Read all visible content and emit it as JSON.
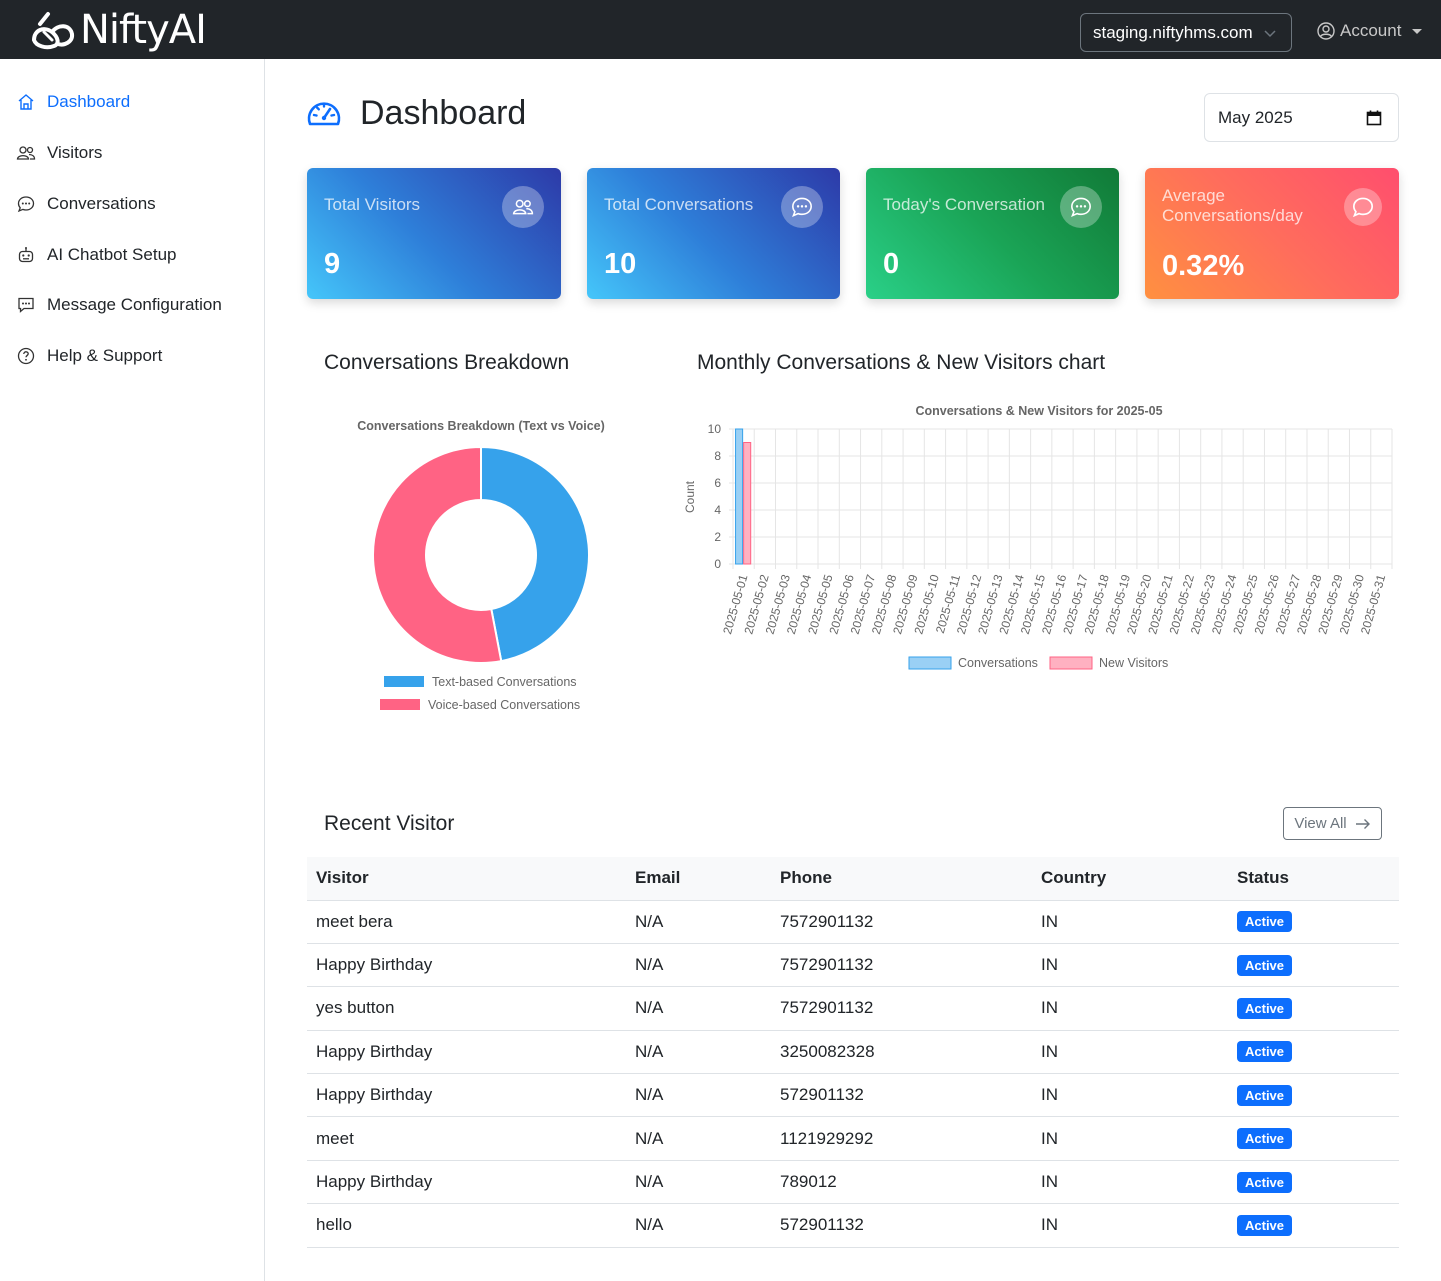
{
  "header": {
    "brand": "NiftyAI",
    "domain": "staging.niftyhms.com",
    "account_label": "Account"
  },
  "sidebar": {
    "items": [
      {
        "label": "Dashboard",
        "icon": "home-icon",
        "active": true
      },
      {
        "label": "Visitors",
        "icon": "people-icon"
      },
      {
        "label": "Conversations",
        "icon": "chat-dots-icon"
      },
      {
        "label": "AI Chatbot Setup",
        "icon": "robot-icon"
      },
      {
        "label": "Message Configuration",
        "icon": "message-square-icon"
      },
      {
        "label": "Help & Support",
        "icon": "question-circle-icon"
      }
    ]
  },
  "page": {
    "title": "Dashboard",
    "month": "May 2025"
  },
  "cards": [
    {
      "label": "Total Visitors",
      "value": "9",
      "icon": "people-icon"
    },
    {
      "label": "Total Conversations",
      "value": "10",
      "icon": "chat-dots-icon"
    },
    {
      "label": "Today's Conversation",
      "value": "0",
      "icon": "chat-dots-icon"
    },
    {
      "label": "Average Conversations/day",
      "value": "0.32%",
      "icon": "chat-icon"
    }
  ],
  "sections": {
    "breakdown_title": "Conversations Breakdown",
    "monthly_title": "Monthly Conversations & New Visitors chart",
    "recent_title": "Recent Visitor",
    "view_all": "View All"
  },
  "colors": {
    "primary": "#0d6efd",
    "text_series": "#36a2eb",
    "voice_series": "#ff6384"
  },
  "chart_data": [
    {
      "type": "pie",
      "title": "Conversations Breakdown (Text vs Voice)",
      "categories": [
        "Text-based Conversations",
        "Voice-based Conversations"
      ],
      "values": [
        47,
        53
      ],
      "legend": "bottom"
    },
    {
      "type": "bar",
      "title": "Conversations & New Visitors for 2025-05",
      "ylabel": "Count",
      "ylim": [
        0,
        10
      ],
      "yticks": [
        0,
        2,
        4,
        6,
        8,
        10
      ],
      "grid": true,
      "legend": "bottom",
      "categories": [
        "2025-05-01",
        "2025-05-02",
        "2025-05-03",
        "2025-05-04",
        "2025-05-05",
        "2025-05-06",
        "2025-05-07",
        "2025-05-08",
        "2025-05-09",
        "2025-05-10",
        "2025-05-11",
        "2025-05-12",
        "2025-05-13",
        "2025-05-14",
        "2025-05-15",
        "2025-05-16",
        "2025-05-17",
        "2025-05-18",
        "2025-05-19",
        "2025-05-20",
        "2025-05-21",
        "2025-05-22",
        "2025-05-23",
        "2025-05-24",
        "2025-05-25",
        "2025-05-26",
        "2025-05-27",
        "2025-05-28",
        "2025-05-29",
        "2025-05-30",
        "2025-05-31"
      ],
      "series": [
        {
          "name": "Conversations",
          "values": [
            10,
            0,
            0,
            0,
            0,
            0,
            0,
            0,
            0,
            0,
            0,
            0,
            0,
            0,
            0,
            0,
            0,
            0,
            0,
            0,
            0,
            0,
            0,
            0,
            0,
            0,
            0,
            0,
            0,
            0,
            0
          ]
        },
        {
          "name": "New Visitors",
          "values": [
            9,
            0,
            0,
            0,
            0,
            0,
            0,
            0,
            0,
            0,
            0,
            0,
            0,
            0,
            0,
            0,
            0,
            0,
            0,
            0,
            0,
            0,
            0,
            0,
            0,
            0,
            0,
            0,
            0,
            0,
            0
          ]
        }
      ]
    }
  ],
  "table": {
    "headers": [
      "Visitor",
      "Email",
      "Phone",
      "Country",
      "Status"
    ],
    "rows": [
      [
        "meet bera",
        "N/A",
        "7572901132",
        "IN",
        "Active"
      ],
      [
        "Happy Birthday",
        "N/A",
        "7572901132",
        "IN",
        "Active"
      ],
      [
        "yes button",
        "N/A",
        "7572901132",
        "IN",
        "Active"
      ],
      [
        "Happy Birthday",
        "N/A",
        "3250082328",
        "IN",
        "Active"
      ],
      [
        "Happy Birthday",
        "N/A",
        "572901132",
        "IN",
        "Active"
      ],
      [
        "meet",
        "N/A",
        "1121929292",
        "IN",
        "Active"
      ],
      [
        "Happy Birthday",
        "N/A",
        "789012",
        "IN",
        "Active"
      ],
      [
        "hello",
        "N/A",
        "572901132",
        "IN",
        "Active"
      ]
    ]
  }
}
